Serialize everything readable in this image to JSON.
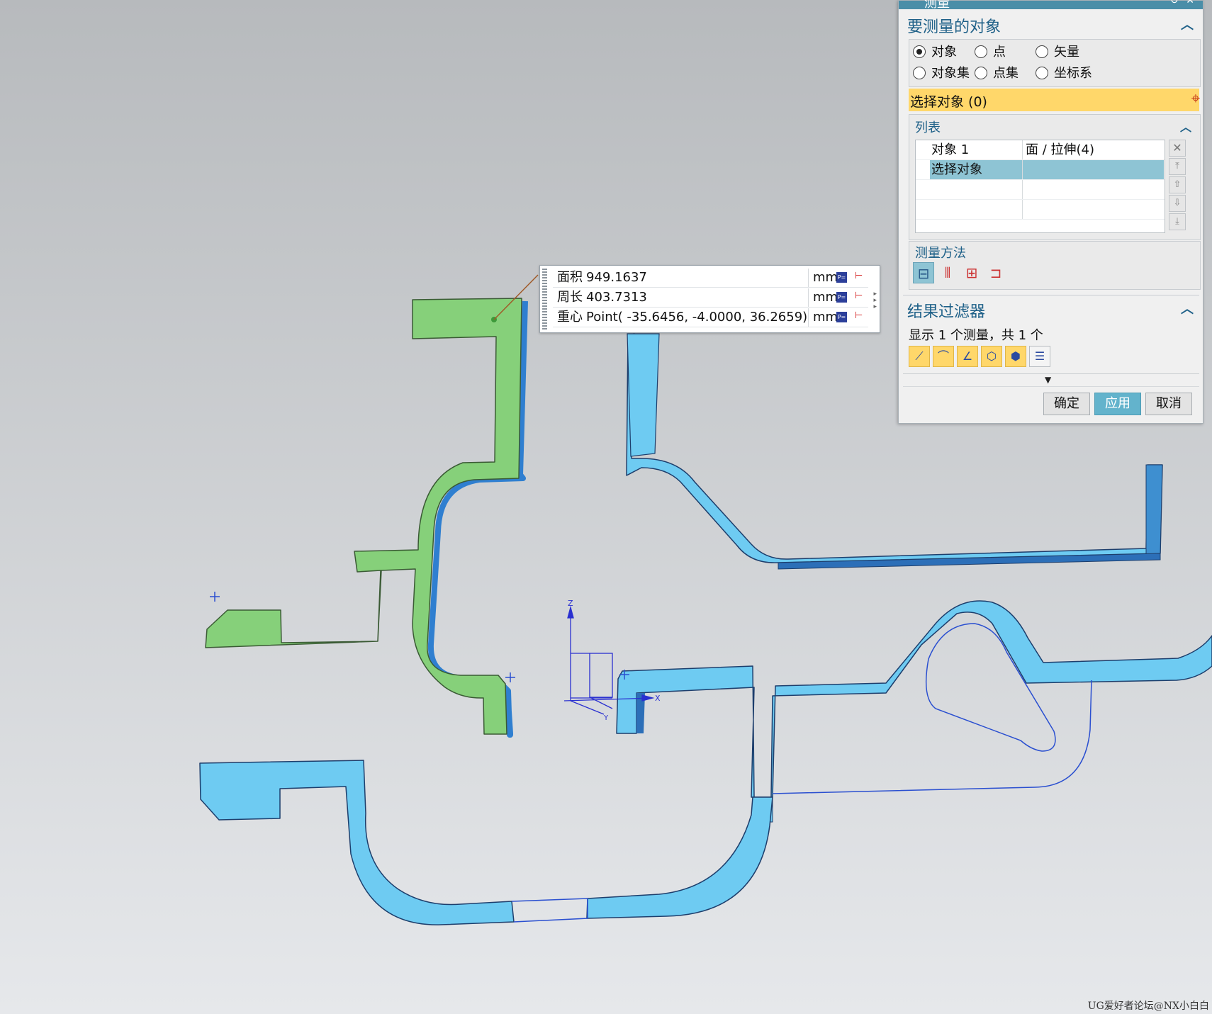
{
  "callout": {
    "rows": [
      {
        "label": "面积",
        "value": "949.1637",
        "unit": "mm²"
      },
      {
        "label": "周长",
        "value": "403.7313",
        "unit": "mm"
      },
      {
        "label": "重心",
        "value": "Point( -35.6456, -4.0000, 36.2659)",
        "unit": "mm"
      }
    ]
  },
  "axes": {
    "z": "Z",
    "x": "X",
    "y": "Y"
  },
  "dialog": {
    "title": "测量",
    "section1": {
      "title": "要测量的对象",
      "radios": [
        {
          "label": "对象",
          "checked": true
        },
        {
          "label": "点",
          "checked": false
        },
        {
          "label": "矢量",
          "checked": false
        },
        {
          "label": "对象集",
          "checked": false
        },
        {
          "label": "点集",
          "checked": false
        },
        {
          "label": "坐标系",
          "checked": false
        }
      ],
      "select_label": "选择对象 (0)"
    },
    "list": {
      "title": "列表",
      "rows": [
        {
          "c1": "对象 1",
          "c2": "面 / 拉伸(4)"
        },
        {
          "c1": "选择对象",
          "c2": ""
        }
      ]
    },
    "method": {
      "title": "测量方法"
    },
    "filter": {
      "title": "结果过滤器",
      "summary": "显示 1 个测量，共 1 个"
    },
    "buttons": {
      "ok": "确定",
      "apply": "应用",
      "cancel": "取消"
    }
  },
  "watermark": "UG爱好者论坛@NX小白白",
  "colors": {
    "selected_face": "#86d07a",
    "body": "#6ecbf2",
    "accent": "#ffd76a"
  }
}
